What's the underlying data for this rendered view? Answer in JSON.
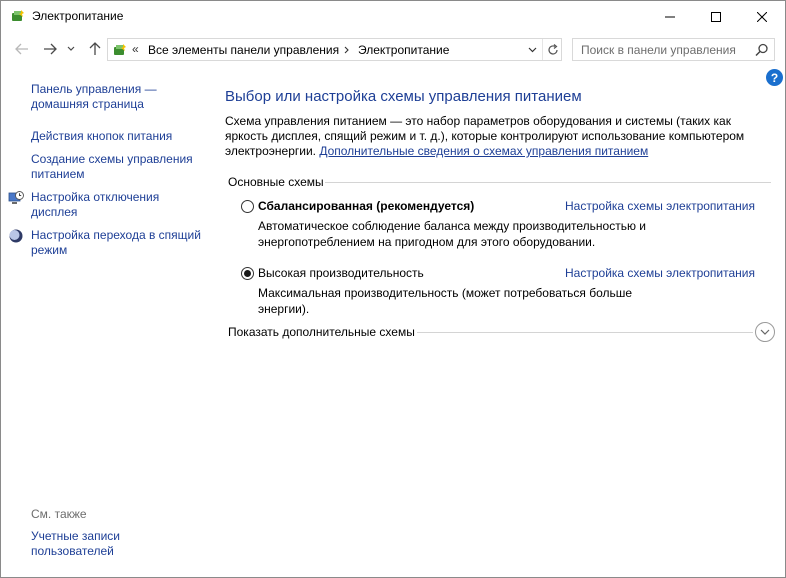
{
  "window": {
    "title": "Электропитание"
  },
  "address": {
    "overflow": "«",
    "crumbs": [
      "Все элементы панели управления",
      "Электропитание"
    ],
    "search_placeholder": "Поиск в панели управления"
  },
  "help": {
    "label": "?"
  },
  "sidebar": {
    "home": "Панель управления — домашняя страница",
    "items": [
      "Действия кнопок питания",
      "Создание схемы управления питанием",
      "Настройка отключения дисплея",
      "Настройка перехода в спящий режим"
    ],
    "see_also": "См. также",
    "see_also_items": [
      "Учетные записи пользователей"
    ]
  },
  "main": {
    "title": "Выбор или настройка схемы управления питанием",
    "description": "Схема управления питанием — это набор параметров оборудования и системы (таких как яркость дисплея, спящий режим и т. д.), которые контролируют использование компьютером электроэнергии. ",
    "description_link": "Дополнительные сведения о схемах управления питанием",
    "group_label": "Основные схемы",
    "plans": [
      {
        "name": "Сбалансированная (рекомендуется)",
        "selected": false,
        "link": "Настройка схемы электропитания",
        "description": "Автоматическое соблюдение баланса между производительностью и энергопотреблением на пригодном для этого оборудовании."
      },
      {
        "name": "Высокая производительность",
        "selected": true,
        "link": "Настройка схемы электропитания",
        "description": "Максимальная производительность (может потребоваться больше энергии)."
      }
    ],
    "show_more": "Показать дополнительные схемы"
  },
  "colors": {
    "link": "#1e3f96",
    "help_badge": "#1a6fce"
  }
}
